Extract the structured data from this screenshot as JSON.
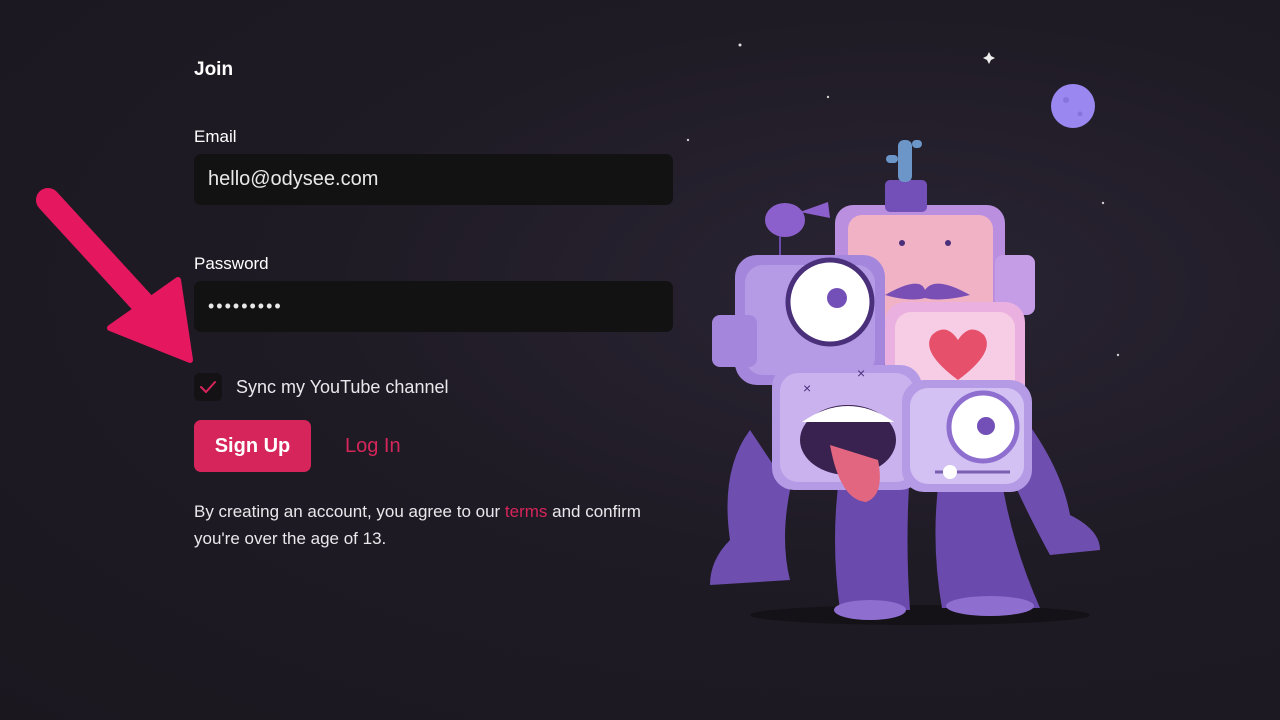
{
  "form": {
    "title": "Join",
    "email_label": "Email",
    "email_value": "hello@odysee.com",
    "password_label": "Password",
    "password_value": "•••••••••",
    "checkbox_label": "Sync my YouTube channel",
    "checkbox_checked": true,
    "signup_label": "Sign Up",
    "login_label": "Log In",
    "disclaimer_prefix": "By creating an account, you agree to our ",
    "disclaimer_link": "terms",
    "disclaimer_suffix": " and confirm you're over the age of 13."
  },
  "colors": {
    "accent": "#d6255a",
    "background": "#1d1a22",
    "input_bg": "#121212"
  },
  "icons": {
    "checkbox": "check-icon",
    "annotation": "pointer-arrow-icon",
    "illustration": "odysee-monster-illustration"
  }
}
